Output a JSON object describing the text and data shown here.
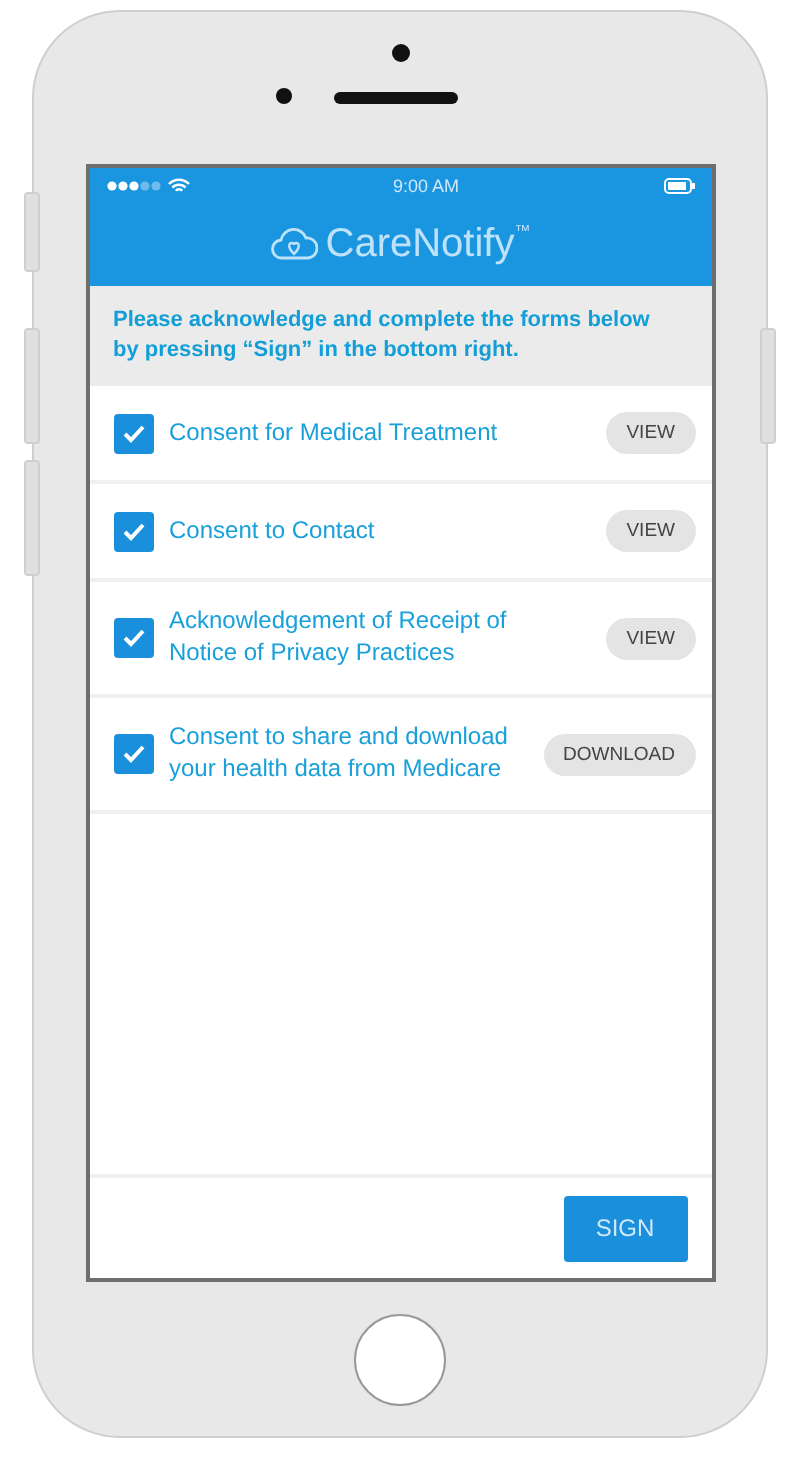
{
  "status_bar": {
    "time": "9:00 AM"
  },
  "header": {
    "brand": "CareNotify",
    "trademark": "™"
  },
  "instructions": "Please acknowledge and complete the forms below by pressing “Sign” in the bottom right.",
  "forms": [
    {
      "label": "Consent for Medical Treatment",
      "checked": true,
      "action": "VIEW"
    },
    {
      "label": "Consent to Contact",
      "checked": true,
      "action": "VIEW"
    },
    {
      "label": "Acknowledgement of Receipt of Notice of Privacy Practices",
      "checked": true,
      "action": "VIEW"
    },
    {
      "label": "Consent to share and download your health data from Medicare",
      "checked": true,
      "action": "DOWNLOAD"
    }
  ],
  "footer": {
    "button": "SIGN"
  }
}
